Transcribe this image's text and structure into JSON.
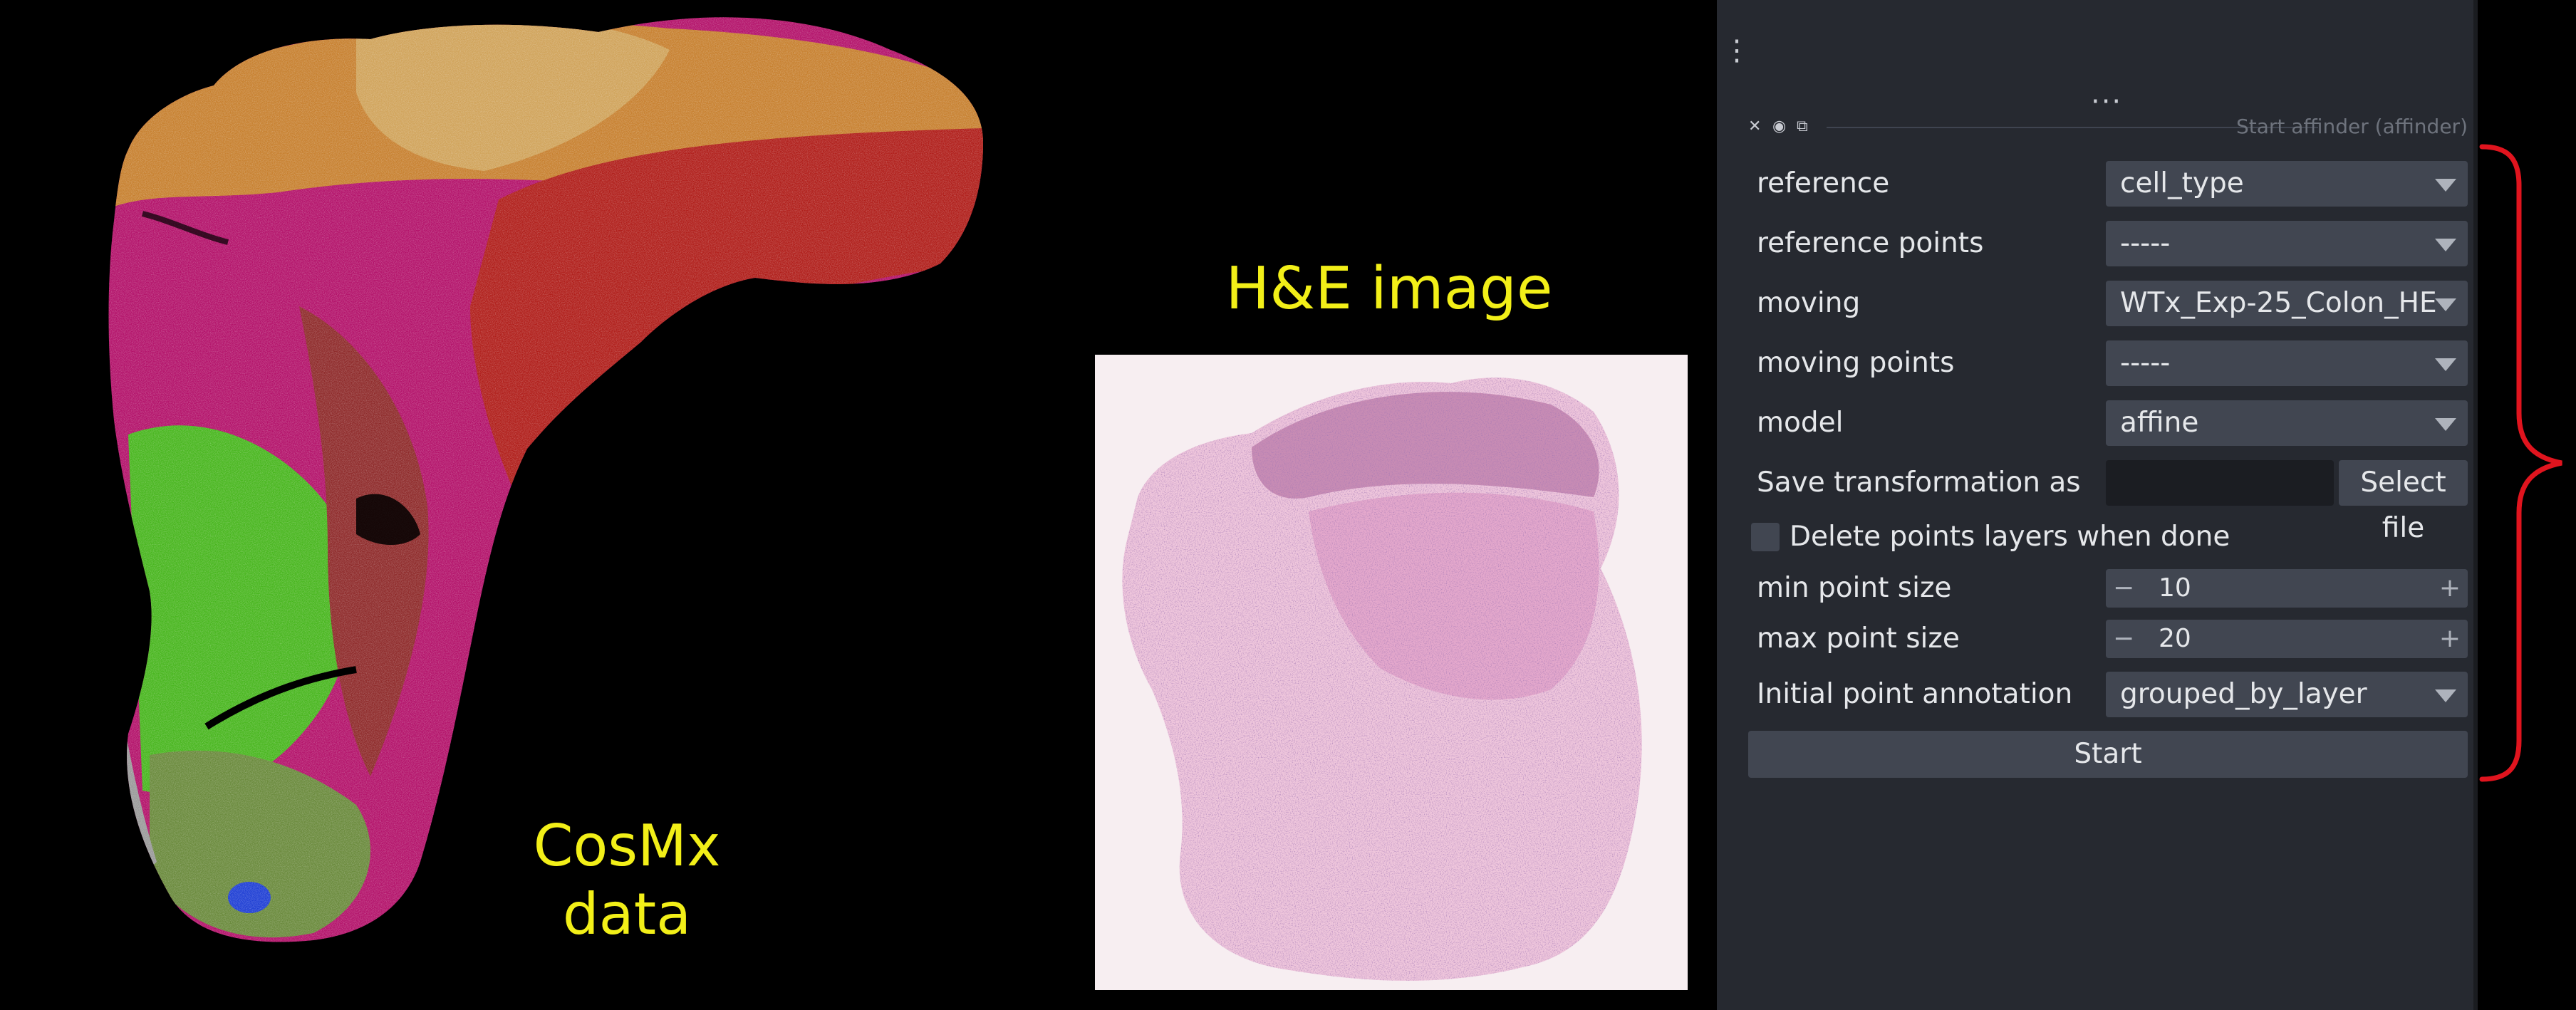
{
  "captions": {
    "cosmx": [
      "CosMx",
      "data"
    ],
    "he": "H&E image"
  },
  "dock": {
    "menu_icon": "kebab-menu-icon",
    "overflow_icon": "ellipsis-icon",
    "titlebar": {
      "icons": [
        "close-icon",
        "float-icon",
        "hide-icon"
      ],
      "title": "Start affinder (affinder)"
    },
    "form": {
      "reference": {
        "label": "reference",
        "value": "cell_type"
      },
      "reference_points": {
        "label": "reference points",
        "value": "-----"
      },
      "moving": {
        "label": "moving",
        "value": "WTx_Exp-25_Colon_HE"
      },
      "moving_points": {
        "label": "moving points",
        "value": "-----"
      },
      "model": {
        "label": "model",
        "value": "affine"
      },
      "save_transformation": {
        "label": "Save transformation as",
        "value": "",
        "button": "Select file"
      },
      "delete_points": {
        "label": "Delete points layers when done",
        "checked": false
      },
      "min_point_size": {
        "label": "min point size",
        "value": "10"
      },
      "max_point_size": {
        "label": "max point size",
        "value": "20"
      },
      "initial_point_annotation": {
        "label": "Initial point annotation",
        "value": "grouped_by_layer"
      },
      "start_label": "Start"
    }
  },
  "colors": {
    "caption": "#f2ef18",
    "dock_bg": "#262930",
    "control_bg": "#414651",
    "brace": "#e0141e",
    "tissue_magenta": "#e5007f",
    "tissue_red": "#c01e14",
    "tissue_green": "#5ad21e",
    "tissue_orange": "#d9752b",
    "he_pink": "#e6a6c8",
    "he_purple": "#5a3072"
  }
}
